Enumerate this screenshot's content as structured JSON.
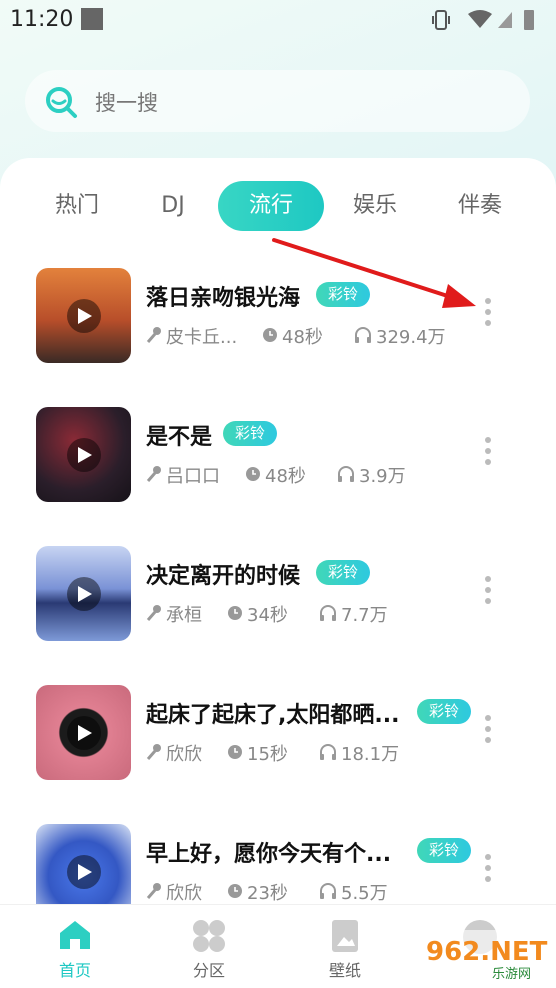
{
  "status_bar": {
    "time": "11:20"
  },
  "search": {
    "placeholder": "搜一搜"
  },
  "tabs": [
    {
      "label": "热门",
      "active": false
    },
    {
      "label": "DJ",
      "active": false
    },
    {
      "label": "流行",
      "active": true
    },
    {
      "label": "娱乐",
      "active": false
    },
    {
      "label": "伴奏",
      "active": false
    }
  ],
  "songs": [
    {
      "title": "落日亲吻银光海",
      "badge": "彩铃",
      "artist": "皮卡丘...",
      "duration": "48秒",
      "plays": "329.4万",
      "cover_color": "#b06a3a"
    },
    {
      "title": "是不是",
      "badge": "彩铃",
      "artist": "吕口口",
      "duration": "48秒",
      "plays": "3.9万",
      "cover_color": "#2a1e2a"
    },
    {
      "title": "决定离开的时候",
      "badge": "彩铃",
      "artist": "承桓",
      "duration": "34秒",
      "plays": "7.7万",
      "cover_color": "#6c86c8"
    },
    {
      "title": "起床了起床了,太阳都晒...",
      "badge": "彩铃",
      "artist": "欣欣",
      "duration": "15秒",
      "plays": "18.1万",
      "cover_color": "#d07a8a"
    },
    {
      "title": "早上好，愿你今天有个...",
      "badge": "彩铃",
      "artist": "欣欣",
      "duration": "23秒",
      "plays": "5.5万",
      "cover_color": "#3f6ad8"
    }
  ],
  "bottom_nav": [
    {
      "label": "首页",
      "icon": "home-icon",
      "active": true
    },
    {
      "label": "分区",
      "icon": "grid-icon",
      "active": false
    },
    {
      "label": "壁纸",
      "icon": "wallpaper-icon",
      "active": false
    }
  ],
  "watermark": {
    "text": "962.NET",
    "subtext": "乐游网"
  },
  "colors": {
    "accent": "#1ec8c3",
    "badge": "#2ec9df"
  }
}
